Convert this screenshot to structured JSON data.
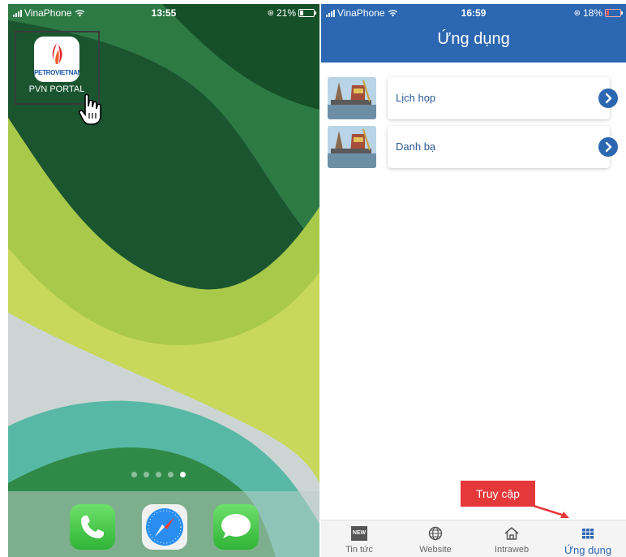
{
  "left_screen": {
    "status_bar": {
      "carrier": "VinaPhone",
      "time": "13:55",
      "battery": "21%",
      "battery_level": 0.21
    },
    "home_app": {
      "name": "PVN PORTAL",
      "brand_text": "PETROVIETNAM",
      "icon": "petrovietnam-flame-logo"
    },
    "page_dots": {
      "count": 5,
      "active_index": 4
    },
    "dock": [
      {
        "name": "phone",
        "icon": "phone-icon"
      },
      {
        "name": "safari",
        "icon": "compass-icon"
      },
      {
        "name": "messages",
        "icon": "message-bubble-icon"
      }
    ]
  },
  "right_screen": {
    "status_bar": {
      "carrier": "VinaPhone",
      "time": "16:59",
      "battery": "18%",
      "battery_level": 0.18
    },
    "header": {
      "title": "Ứng dụng",
      "color": "#2c67b1"
    },
    "apps": [
      {
        "label": "Lịch họp",
        "icon": "chevron-right-circle-icon"
      },
      {
        "label": "Danh bạ",
        "icon": "chevron-right-circle-icon"
      }
    ],
    "callout": {
      "text": "Truy cập",
      "color": "#e5383b"
    },
    "tabs": [
      {
        "label": "Tin tức",
        "icon": "news-icon",
        "icon_text": "NEW",
        "active": false
      },
      {
        "label": "Website",
        "icon": "globe-icon",
        "active": false
      },
      {
        "label": "Intraweb",
        "icon": "home-icon",
        "active": false
      },
      {
        "label": "Ứng dụng",
        "icon": "grid-icon",
        "active": true
      }
    ],
    "accent_color": "#2c67b1"
  }
}
